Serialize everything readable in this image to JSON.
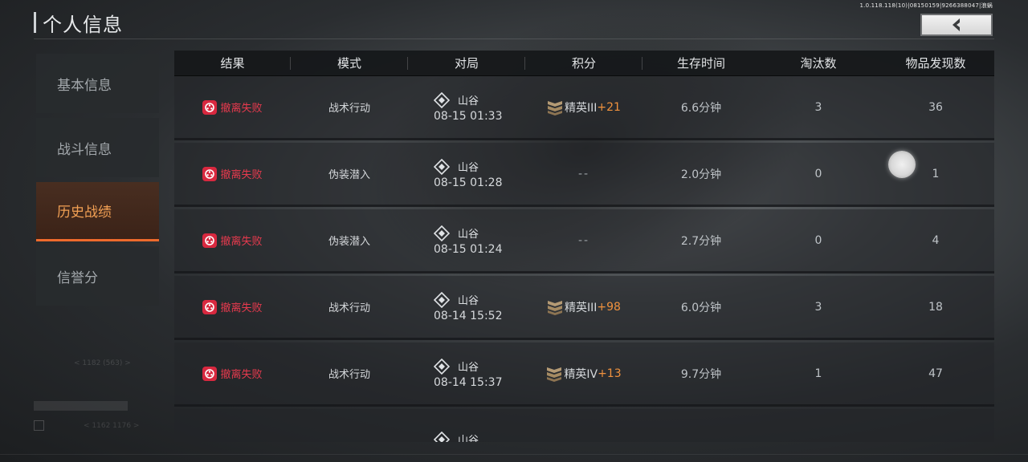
{
  "status_text": "1.0.118.118(10)|08150159|9266388047|浪蜗",
  "title": "个人信息",
  "sidebar": {
    "items": [
      {
        "label": "基本信息",
        "active": false
      },
      {
        "label": "战斗信息",
        "active": false
      },
      {
        "label": "历史战绩",
        "active": true
      },
      {
        "label": "信誉分",
        "active": false
      }
    ],
    "faint_text": "< 1182 (563) >",
    "faint_text_2": "< 1162 1176 >"
  },
  "table": {
    "headers": [
      "结果",
      "模式",
      "对局",
      "积分",
      "生存时间",
      "淘汰数",
      "物品发现数"
    ],
    "rows": [
      {
        "result": "撤离失败",
        "mode": "战术行动",
        "map": "山谷",
        "time": "08-15 01:33",
        "rank": "精英III",
        "delta": "+21",
        "survival": "6.6分钟",
        "kills": "3",
        "items": "36"
      },
      {
        "result": "撤离失败",
        "mode": "伪装潜入",
        "map": "山谷",
        "time": "08-15 01:28",
        "rank": "",
        "delta": "",
        "dash": "--",
        "survival": "2.0分钟",
        "kills": "0",
        "items": "1"
      },
      {
        "result": "撤离失败",
        "mode": "伪装潜入",
        "map": "山谷",
        "time": "08-15 01:24",
        "rank": "",
        "delta": "",
        "dash": "--",
        "survival": "2.7分钟",
        "kills": "0",
        "items": "4"
      },
      {
        "result": "撤离失败",
        "mode": "战术行动",
        "map": "山谷",
        "time": "08-14 15:52",
        "rank": "精英III",
        "delta": "+98",
        "survival": "6.0分钟",
        "kills": "3",
        "items": "18"
      },
      {
        "result": "撤离失败",
        "mode": "战术行动",
        "map": "山谷",
        "time": "08-14 15:37",
        "rank": "精英IV",
        "delta": "+13",
        "survival": "9.7分钟",
        "kills": "1",
        "items": "47"
      },
      {
        "result": "",
        "mode": "",
        "map": "山谷",
        "time": "",
        "rank": "",
        "delta": "",
        "survival": "",
        "kills": "",
        "items": ""
      }
    ]
  },
  "colors": {
    "accent_orange": "#ee6a2c",
    "fail_red": "#e83a4e",
    "delta_orange": "#f0923e"
  },
  "icons": {
    "back": "chevron-left-icon",
    "result": "fail-badge-icon",
    "map": "map-pin-icon",
    "rank": "rank-badge-icon"
  }
}
